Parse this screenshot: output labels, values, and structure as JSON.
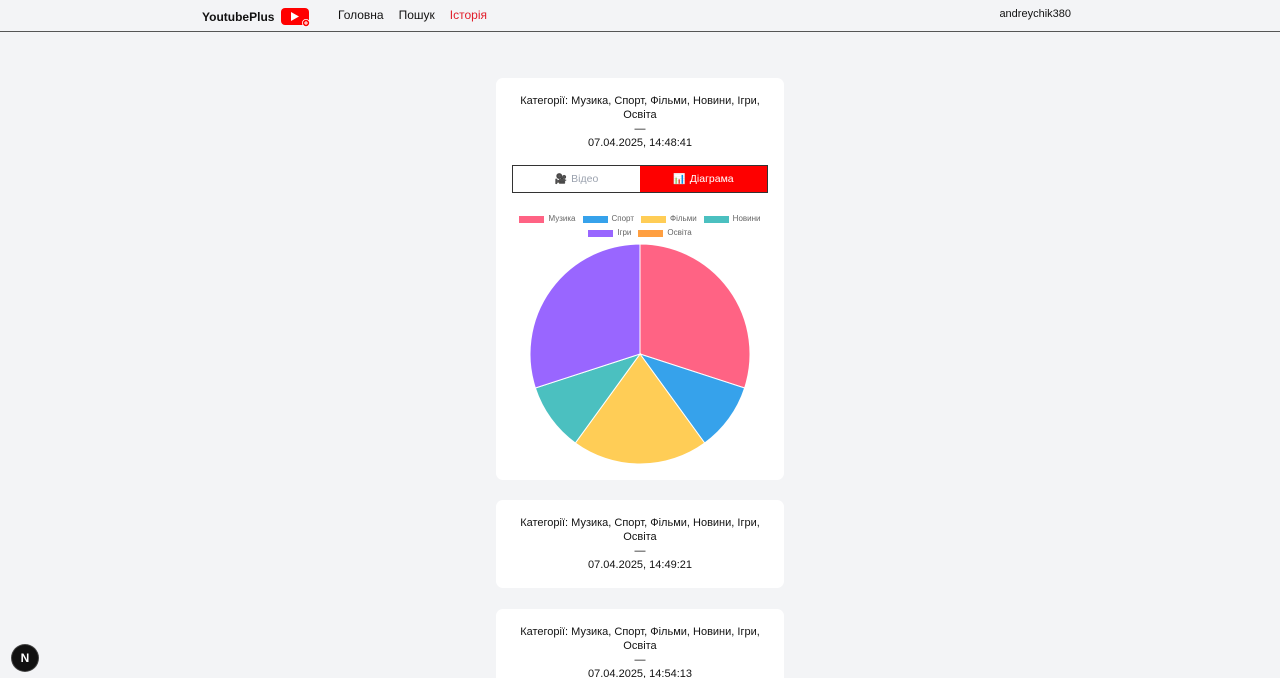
{
  "header": {
    "brand": "YoutubePlus",
    "nav": [
      "Головна",
      "Пошук",
      "Історія"
    ],
    "active_nav": "Історія",
    "username": "andreychik380"
  },
  "history": [
    {
      "categories": "Категорії: Музика, Спорт, Фільми, Новини, Ігри, Освіта",
      "separator": "—",
      "datetime": "07.04.2025, 14:48:41",
      "tabs": {
        "video": "Відео",
        "chart": "Діаграма"
      },
      "active_tab": "chart"
    },
    {
      "categories": "Категорії: Музика, Спорт, Фільми, Новини, Ігри, Освіта",
      "separator": "—",
      "datetime": "07.04.2025, 14:49:21"
    },
    {
      "categories": "Категорії: Музика, Спорт, Фільми, Новини, Ігри, Освіта",
      "separator": "—",
      "datetime": "07.04.2025, 14:54:13"
    }
  ],
  "icons": {
    "brand": "youtube-plus-icon",
    "video": "video-camera-icon",
    "chart": "bar-chart-icon",
    "badge": "nextjs-icon"
  },
  "badge_letter": "N",
  "colors": {
    "accent": "#fe0000",
    "active_nav": "#e11d2a",
    "background": "#f3f4f6"
  },
  "chart_data": {
    "type": "pie",
    "categories": [
      "Музика",
      "Спорт",
      "Фільми",
      "Новини",
      "Ігри",
      "Освіта"
    ],
    "values": [
      30,
      10,
      20,
      10,
      30,
      0
    ],
    "colors": [
      "#ff6384",
      "#36a2eb",
      "#ffcd56",
      "#4bc0c0",
      "#9966ff",
      "#ff9f40"
    ],
    "legend": "top"
  }
}
